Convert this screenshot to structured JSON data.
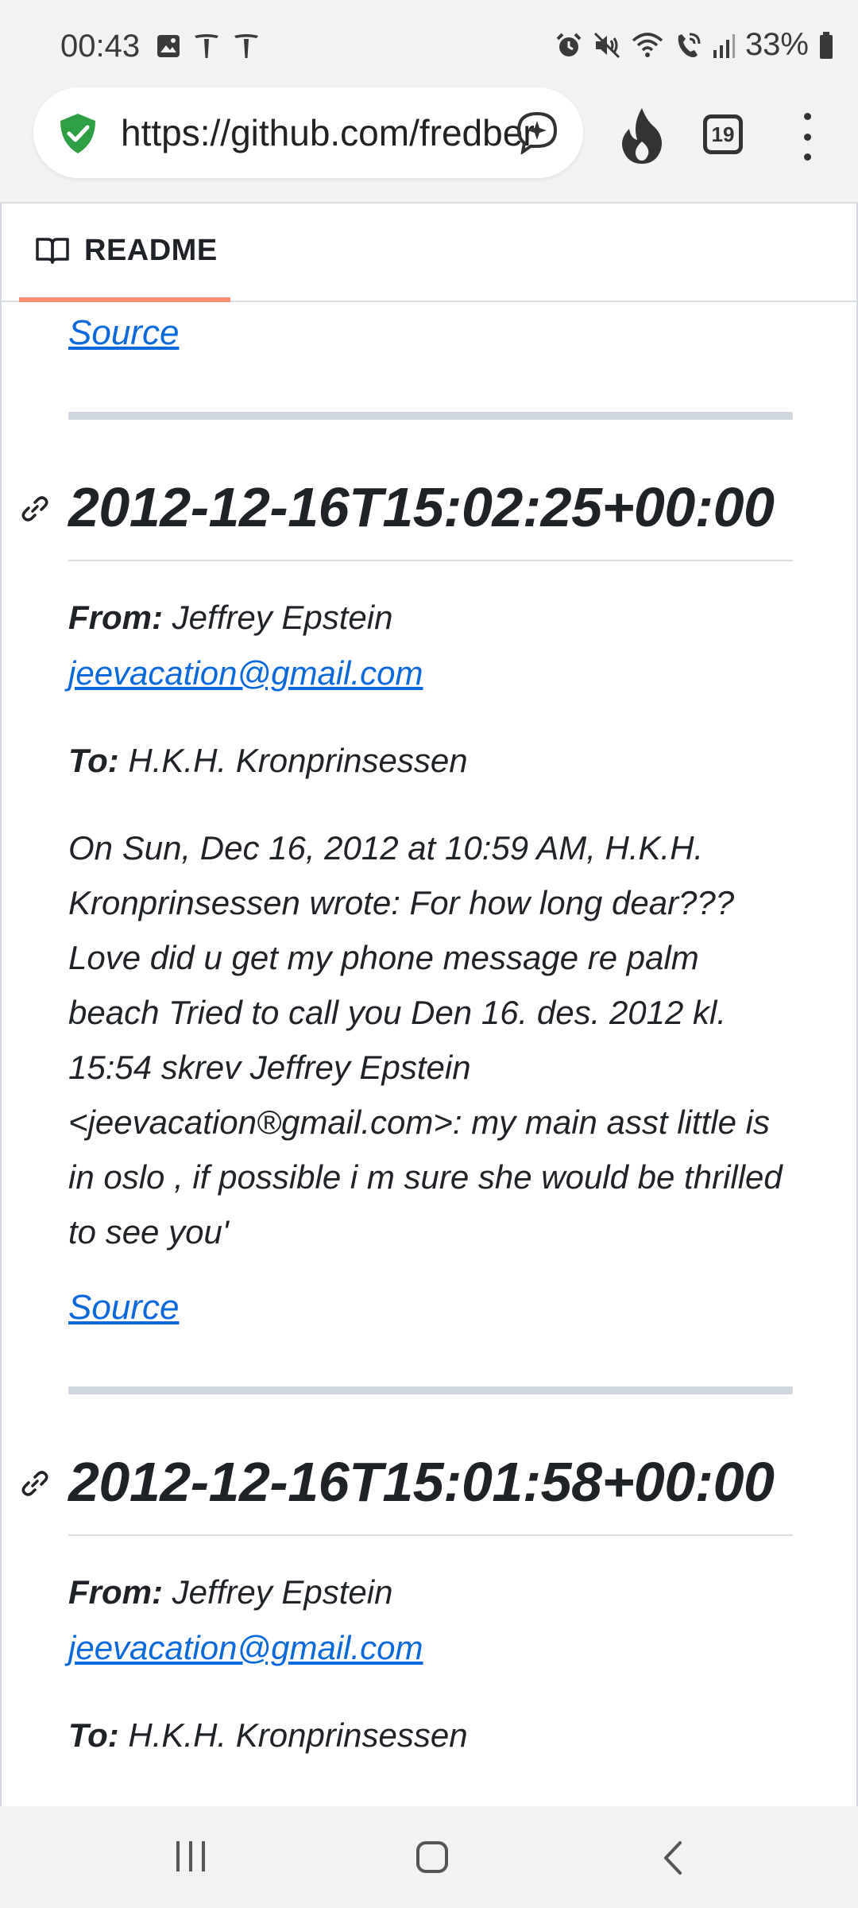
{
  "status_bar": {
    "time": "00:43",
    "battery": "33%",
    "icons_left": [
      "image-icon",
      "tesla-icon",
      "tesla-icon"
    ],
    "icons_right": [
      "alarm-icon",
      "mute-icon",
      "wifi-icon",
      "wifi-call-icon",
      "signal-icon",
      "battery-icon"
    ]
  },
  "browser": {
    "url": "https://github.com/fredbernard",
    "tab_count": "19"
  },
  "readme_tab": {
    "label": "README"
  },
  "top_source": "Source",
  "entries": [
    {
      "timestamp": "2012-12-16T15:02:25+00:00",
      "from_label": "From:",
      "from_name": "Jeffrey Epstein",
      "from_email": "jeevacation@gmail.com",
      "to_label": "To:",
      "to_name": "H.K.H. Kronprinsessen",
      "body": "On Sun, Dec 16, 2012 at 10:59 AM, H.K.H. Kronprinsessen wrote: For how long dear??? Love did u get my phone message re palm beach Tried to call you Den 16. des. 2012 kl. 15:54 skrev Jeffrey Epstein <jeevacation®gmail.com>: my main asst little is in oslo , if possible i m sure she would be thrilled to see you'",
      "source": "Source"
    },
    {
      "timestamp": "2012-12-16T15:01:58+00:00",
      "from_label": "From:",
      "from_name": "Jeffrey Epstein",
      "from_email": "jeevacation@gmail.com",
      "to_label": "To:",
      "to_name": "H.K.H. Kronprinsessen"
    }
  ],
  "colors": {
    "link": "#0969da",
    "tab_underline": "#fd8c73",
    "divider": "#d0d7de",
    "shield": "#2ea043"
  }
}
